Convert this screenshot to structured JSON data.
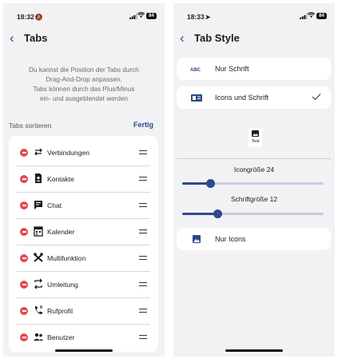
{
  "colors": {
    "accent": "#2c4a8a",
    "danger": "#e5484d",
    "background": "#f2f2f4",
    "card": "#ffffff"
  },
  "left_screen": {
    "status": {
      "time": "18:32",
      "indicator_icon": "silent-bell-icon",
      "battery": "84"
    },
    "nav": {
      "back_icon": "chevron-left-icon",
      "title": "Tabs"
    },
    "info_lines": [
      "Du kannst die Position der Tabs durch",
      "Drag-And-Drop anpassen.",
      "Tabs können durch das Plus/Minus",
      "ein- und ausgeblendet werden"
    ],
    "section_label": "Tabs sortieren",
    "done_label": "Fertig",
    "tabs": [
      {
        "label": "Verbindungen",
        "icon": "arrows-swap-icon"
      },
      {
        "label": "Kontakte",
        "icon": "contact-card-icon"
      },
      {
        "label": "Chat",
        "icon": "chat-bubble-icon"
      },
      {
        "label": "Kalender",
        "icon": "calendar-icon"
      },
      {
        "label": "Multifunktion",
        "icon": "tools-icon"
      },
      {
        "label": "Umleitung",
        "icon": "redirect-icon"
      },
      {
        "label": "Rufprofil",
        "icon": "phone-profile-icon"
      },
      {
        "label": "Benutzer",
        "icon": "users-icon"
      }
    ]
  },
  "right_screen": {
    "status": {
      "time": "18:33",
      "indicator_icon": "location-arrow-icon",
      "battery": "84"
    },
    "nav": {
      "back_icon": "chevron-left-icon",
      "title": "Tab Style"
    },
    "options": [
      {
        "label": "Nur Schrift",
        "icon": "abc-text-icon",
        "selected": false
      },
      {
        "label": "Icons und Schrift",
        "icon": "icon-and-text-icon",
        "selected": true
      }
    ],
    "preview_text": "Text",
    "icon_size": {
      "label": "Icongröße 24",
      "value_fraction": 0.2
    },
    "font_size": {
      "label": "Schriftgröße 12",
      "value_fraction": 0.25
    },
    "icons_only": {
      "label": "Nur Icons",
      "icon": "image-icon"
    }
  }
}
